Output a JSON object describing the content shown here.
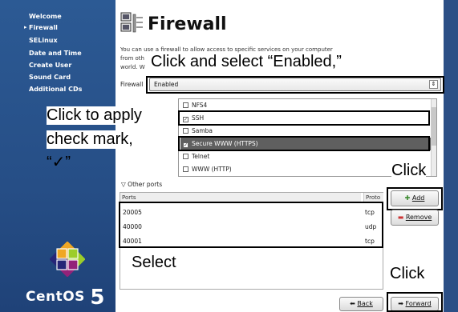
{
  "sidebar": {
    "steps": [
      "Welcome",
      "Firewall",
      "SELinux",
      "Date and Time",
      "Create User",
      "Sound Card",
      "Additional CDs"
    ],
    "active_step": "Firewall",
    "brand": "CentOS",
    "brand_version": "5"
  },
  "page": {
    "title": "Firewall",
    "description_lines": [
      "You can use a firewall to allow access to specific services on your computer",
      "from oth",
      "world. W"
    ]
  },
  "firewall": {
    "label": "Firewall",
    "value": "Enabled"
  },
  "services": [
    {
      "label": "NFS4",
      "checked": false,
      "highlighted": false
    },
    {
      "label": "SSH",
      "checked": true,
      "highlighted": false
    },
    {
      "label": "Samba",
      "checked": false,
      "highlighted": false
    },
    {
      "label": "Secure WWW (HTTPS)",
      "checked": true,
      "highlighted": true
    },
    {
      "label": "Telnet",
      "checked": false,
      "highlighted": false
    },
    {
      "label": "WWW (HTTP)",
      "checked": false,
      "highlighted": false
    }
  ],
  "other_ports": {
    "toggle_label": "Other ports",
    "columns": [
      "Ports",
      "Proto"
    ],
    "rows": [
      {
        "port": "20005",
        "proto": "tcp"
      },
      {
        "port": "40000",
        "proto": "udp"
      },
      {
        "port": "40001",
        "proto": "tcp"
      }
    ]
  },
  "buttons": {
    "add": "Add",
    "remove": "Remove",
    "back": "Back",
    "forward": "Forward"
  },
  "annotations": {
    "select_enabled": "Click and select “Enabled,”",
    "apply_check_1": "Click to apply",
    "apply_check_2": "check mark,",
    "apply_check_3": "“✓”",
    "click_add": "Click",
    "select_ports": "Select",
    "click_forward": "Click"
  }
}
